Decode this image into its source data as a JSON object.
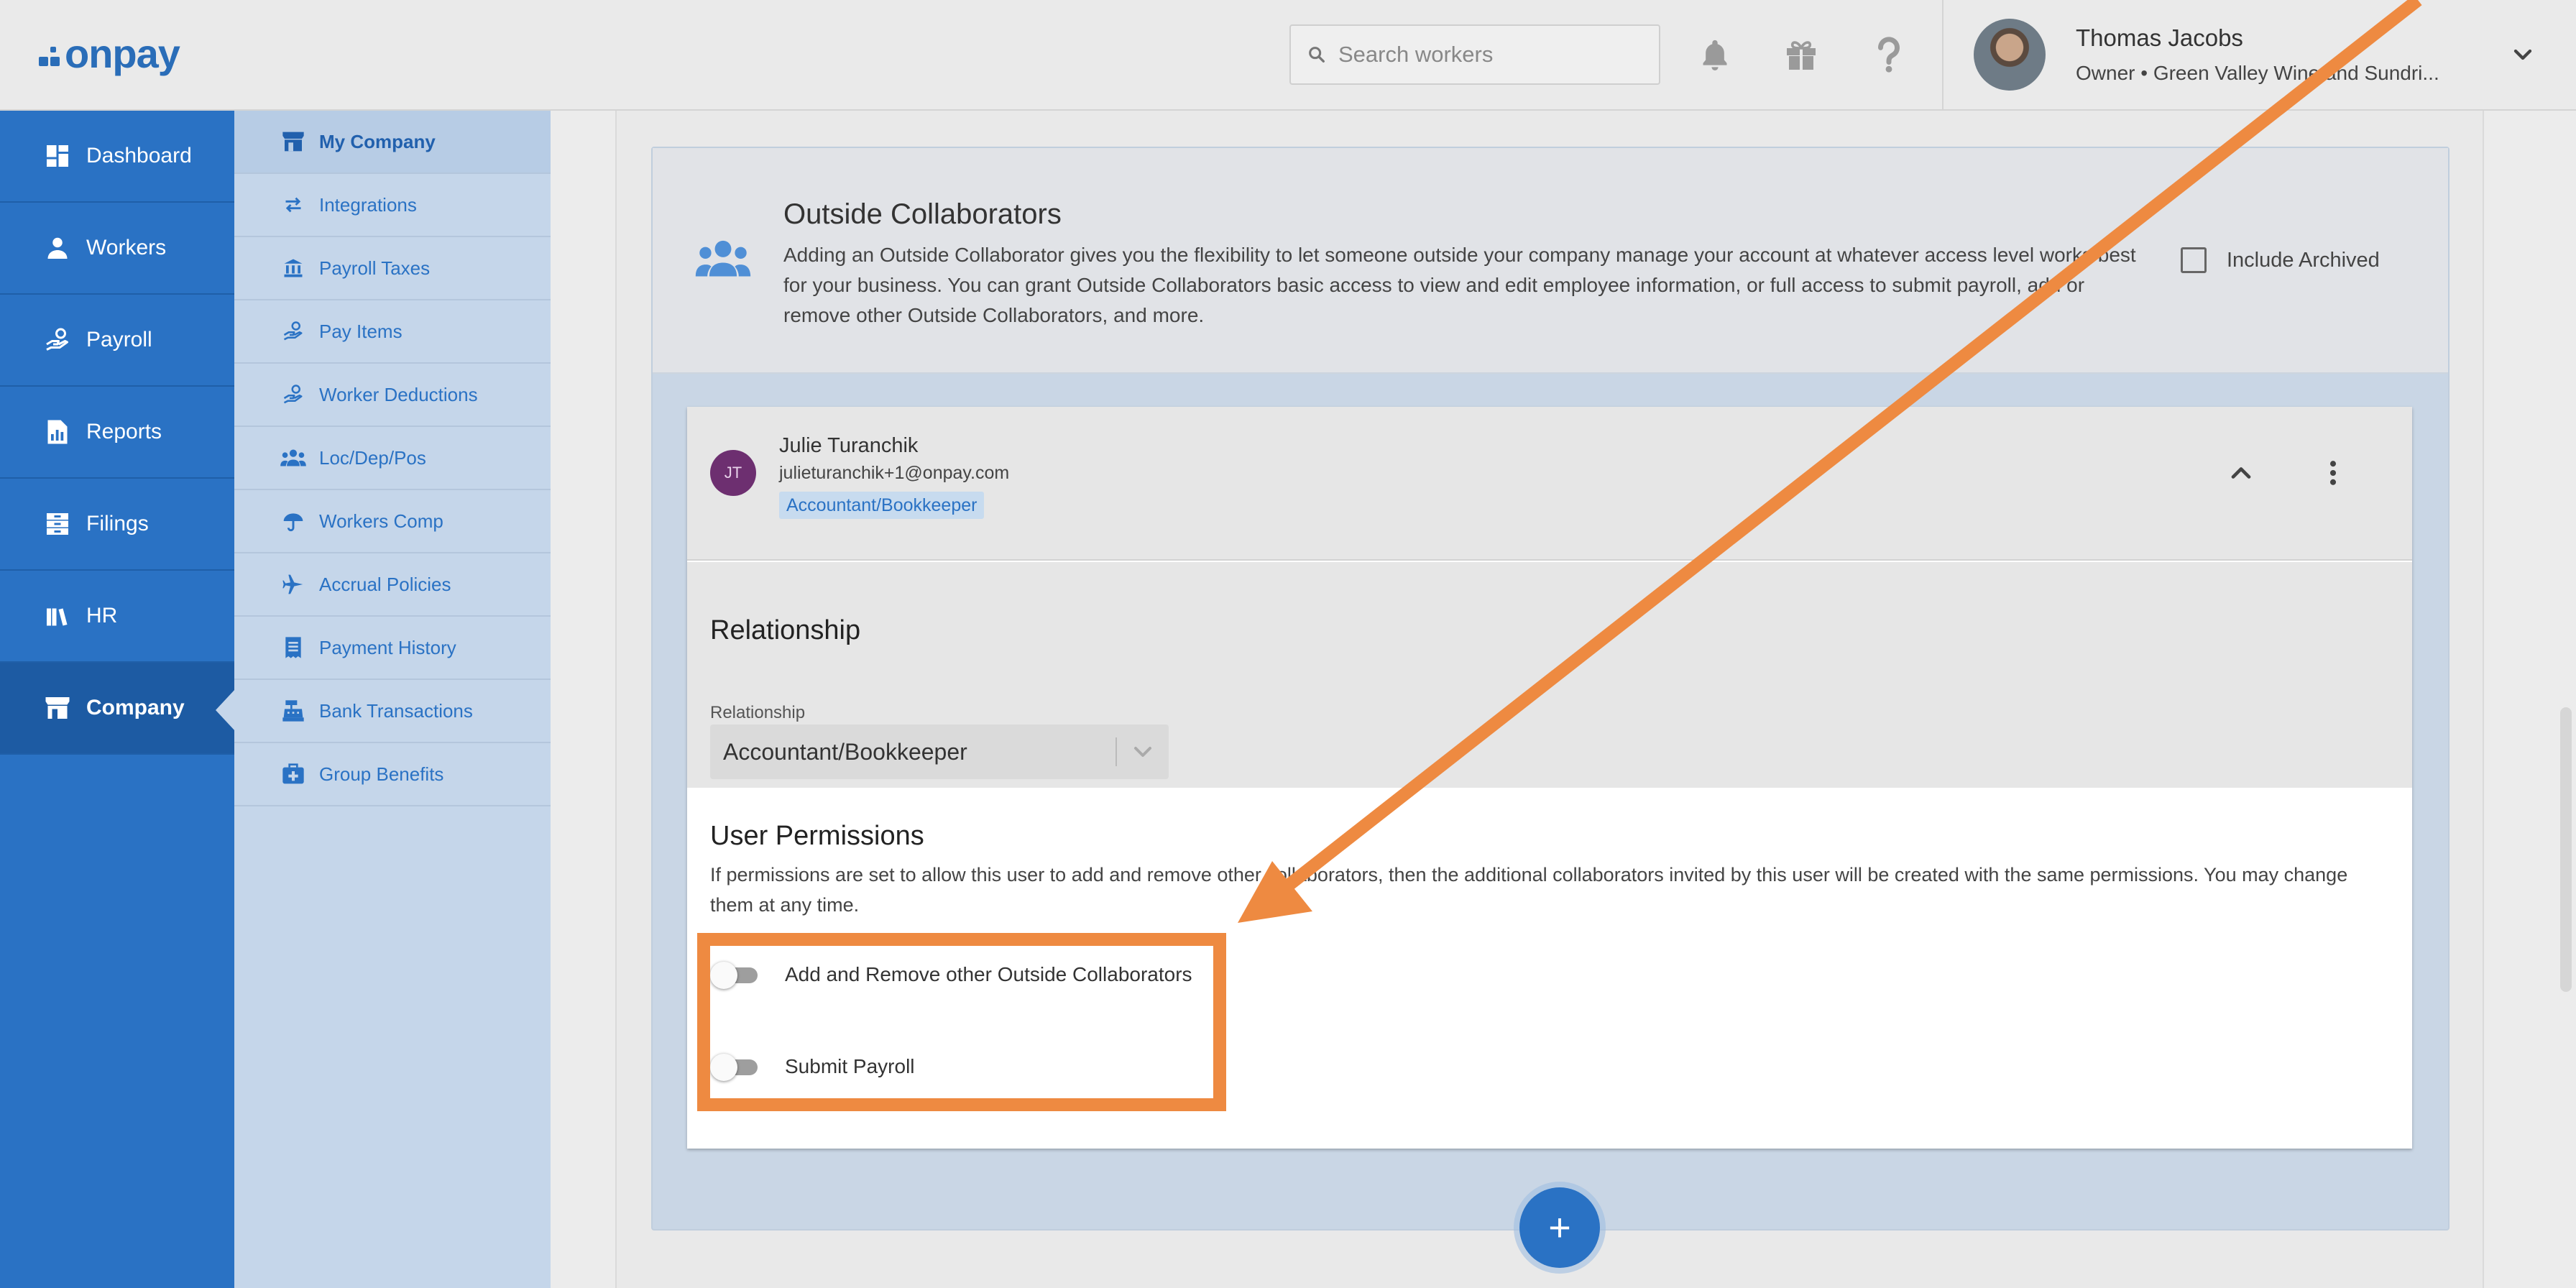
{
  "app": {
    "logo_text": "onpay",
    "brand_color": "#2a6db8"
  },
  "topbar": {
    "search": {
      "placeholder": "Search workers"
    },
    "icons": [
      "bell-icon",
      "gift-icon",
      "help-icon"
    ],
    "user": {
      "name": "Thomas Jacobs",
      "role": "Owner • Green Valley Wine and Sundri..."
    }
  },
  "main_nav": {
    "items": [
      {
        "label": "Dashboard",
        "icon": "dashboard-icon"
      },
      {
        "label": "Workers",
        "icon": "workers-icon"
      },
      {
        "label": "Payroll",
        "icon": "payroll-icon"
      },
      {
        "label": "Reports",
        "icon": "reports-icon"
      },
      {
        "label": "Filings",
        "icon": "filings-icon"
      },
      {
        "label": "HR",
        "icon": "hr-icon"
      },
      {
        "label": "Company",
        "icon": "company-icon",
        "active": true
      }
    ]
  },
  "sub_nav": {
    "items": [
      {
        "label": "My Company",
        "icon": "store-icon",
        "active": true
      },
      {
        "label": "Integrations",
        "icon": "swap-icon"
      },
      {
        "label": "Payroll Taxes",
        "icon": "bank-icon"
      },
      {
        "label": "Pay Items",
        "icon": "hand-coin-icon"
      },
      {
        "label": "Worker Deductions",
        "icon": "hand-coin-icon"
      },
      {
        "label": "Loc/Dep/Pos",
        "icon": "people-icon"
      },
      {
        "label": "Workers Comp",
        "icon": "umbrella-icon"
      },
      {
        "label": "Accrual Policies",
        "icon": "plane-icon"
      },
      {
        "label": "Payment History",
        "icon": "receipt-icon"
      },
      {
        "label": "Bank Transactions",
        "icon": "cash-register-icon"
      },
      {
        "label": "Group Benefits",
        "icon": "medical-bag-icon"
      }
    ]
  },
  "collaborators": {
    "title": "Outside Collaborators",
    "description": "Adding an Outside Collaborator gives you the flexibility to let someone outside your company manage your account at whatever access level works best for your business. You can grant Outside Collaborators basic access to view and edit employee information, or full access to submit payroll, add or remove other Outside Collaborators, and more.",
    "include_archived_label": "Include Archived",
    "include_archived_checked": false
  },
  "collaborator_card": {
    "initials": "JT",
    "name": "Julie Turanchik",
    "email": "julieturanchik+1@onpay.com",
    "badge": "Accountant/Bookkeeper",
    "relationship": {
      "section_title": "Relationship",
      "field_label": "Relationship",
      "selected": "Accountant/Bookkeeper"
    },
    "permissions": {
      "section_title": "User Permissions",
      "description": "If permissions are set to allow this user to add and remove other collaborators, then the additional collaborators invited by this user will be created with the same permissions. You may change them at any time.",
      "items": [
        {
          "label": "Add and Remove other Outside Collaborators",
          "enabled": false
        },
        {
          "label": "Submit Payroll",
          "enabled": false
        }
      ]
    }
  },
  "fab": {
    "label": "+"
  },
  "annotation_color": "#ee8a41"
}
